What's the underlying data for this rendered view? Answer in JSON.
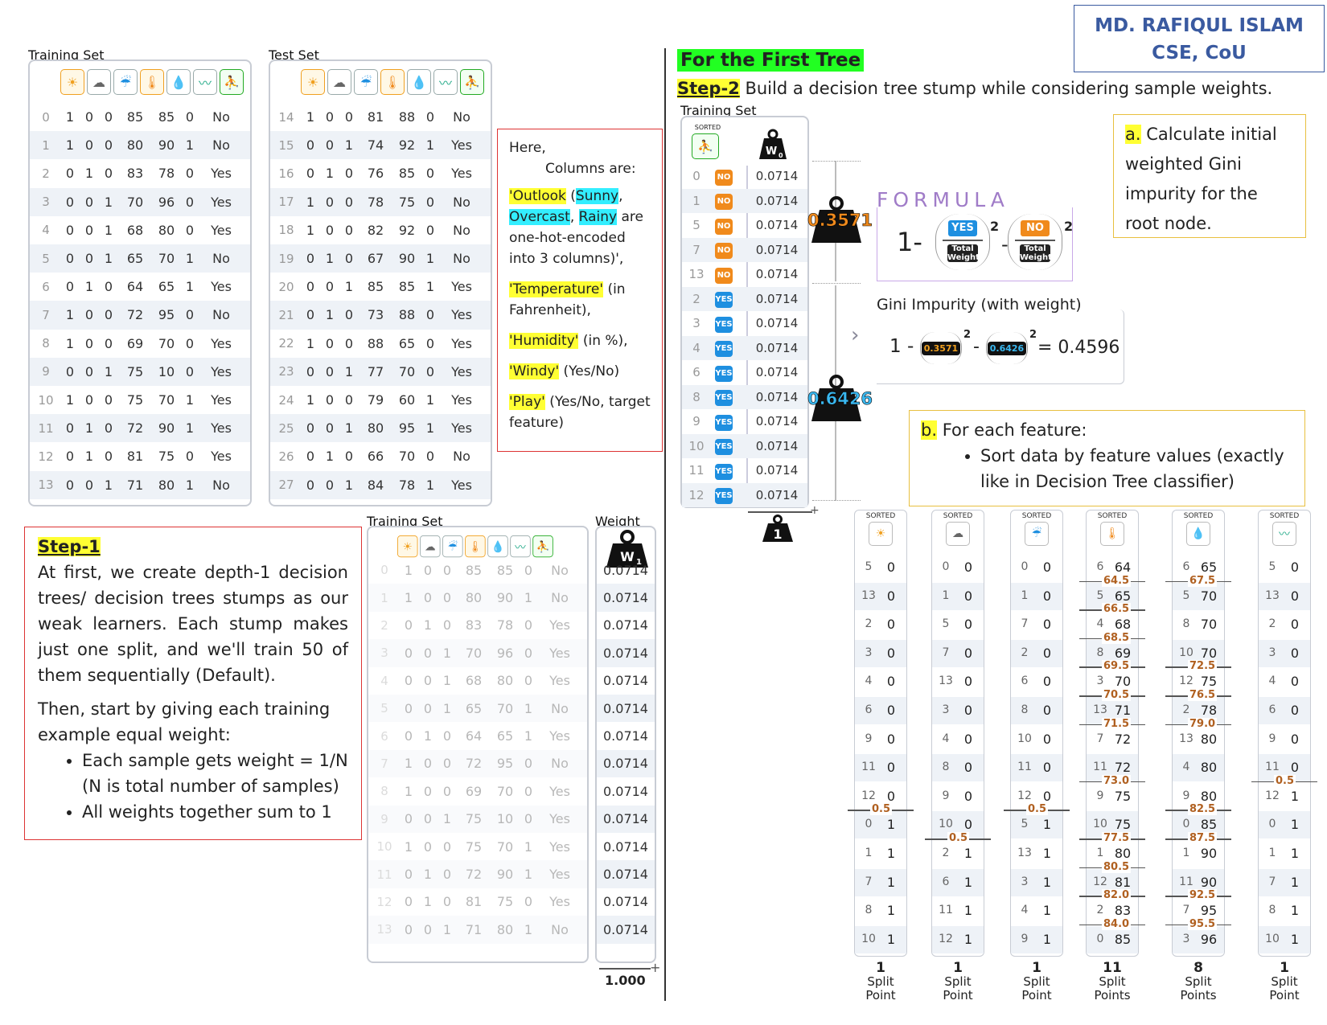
{
  "author": {
    "name": "MD. RAFIQUL ISLAM",
    "dept": "CSE, CoU"
  },
  "training_title": "Training Set",
  "test_title": "Test Set",
  "feature_icons": [
    "sunny-icon",
    "overcast-icon",
    "rainy-icon",
    "temperature-icon",
    "humidity-icon",
    "windy-icon",
    "play-icon"
  ],
  "training_rows": [
    [
      "0",
      "1",
      "0",
      "0",
      "85",
      "85",
      "0",
      "No"
    ],
    [
      "1",
      "1",
      "0",
      "0",
      "80",
      "90",
      "1",
      "No"
    ],
    [
      "2",
      "0",
      "1",
      "0",
      "83",
      "78",
      "0",
      "Yes"
    ],
    [
      "3",
      "0",
      "0",
      "1",
      "70",
      "96",
      "0",
      "Yes"
    ],
    [
      "4",
      "0",
      "0",
      "1",
      "68",
      "80",
      "0",
      "Yes"
    ],
    [
      "5",
      "0",
      "0",
      "1",
      "65",
      "70",
      "1",
      "No"
    ],
    [
      "6",
      "0",
      "1",
      "0",
      "64",
      "65",
      "1",
      "Yes"
    ],
    [
      "7",
      "1",
      "0",
      "0",
      "72",
      "95",
      "0",
      "No"
    ],
    [
      "8",
      "1",
      "0",
      "0",
      "69",
      "70",
      "0",
      "Yes"
    ],
    [
      "9",
      "0",
      "0",
      "1",
      "75",
      "10",
      "0",
      "Yes"
    ],
    [
      "10",
      "1",
      "0",
      "0",
      "75",
      "70",
      "1",
      "Yes"
    ],
    [
      "11",
      "0",
      "1",
      "0",
      "72",
      "90",
      "1",
      "Yes"
    ],
    [
      "12",
      "0",
      "1",
      "0",
      "81",
      "75",
      "0",
      "Yes"
    ],
    [
      "13",
      "0",
      "0",
      "1",
      "71",
      "80",
      "1",
      "No"
    ]
  ],
  "test_rows": [
    [
      "14",
      "1",
      "0",
      "0",
      "81",
      "88",
      "0",
      "No"
    ],
    [
      "15",
      "0",
      "0",
      "1",
      "74",
      "92",
      "1",
      "Yes"
    ],
    [
      "16",
      "0",
      "1",
      "0",
      "76",
      "85",
      "0",
      "Yes"
    ],
    [
      "17",
      "1",
      "0",
      "0",
      "78",
      "75",
      "0",
      "No"
    ],
    [
      "18",
      "1",
      "0",
      "0",
      "82",
      "92",
      "0",
      "No"
    ],
    [
      "19",
      "0",
      "1",
      "0",
      "67",
      "90",
      "1",
      "No"
    ],
    [
      "20",
      "0",
      "0",
      "1",
      "85",
      "85",
      "1",
      "Yes"
    ],
    [
      "21",
      "0",
      "1",
      "0",
      "73",
      "88",
      "0",
      "Yes"
    ],
    [
      "22",
      "1",
      "0",
      "0",
      "88",
      "65",
      "0",
      "Yes"
    ],
    [
      "23",
      "0",
      "0",
      "1",
      "77",
      "70",
      "0",
      "Yes"
    ],
    [
      "24",
      "1",
      "0",
      "0",
      "79",
      "60",
      "1",
      "Yes"
    ],
    [
      "25",
      "0",
      "0",
      "1",
      "80",
      "95",
      "1",
      "Yes"
    ],
    [
      "26",
      "0",
      "1",
      "0",
      "66",
      "70",
      "0",
      "No"
    ],
    [
      "27",
      "0",
      "0",
      "1",
      "84",
      "78",
      "1",
      "Yes"
    ]
  ],
  "note": {
    "here": "Here,",
    "cols": "Columns are:",
    "outlook": "'Outlook",
    "open": " (",
    "sunny": "Sunny",
    ",": ",",
    "overcast": "Overcast",
    "rainy": "Rainy",
    "are": " are",
    "encoded": "one-hot-encoded into 3 columns)',",
    "temperature": "'Temperature'",
    "temp_unit": " (in Fahrenheit),",
    "humidity": "'Humidity'",
    "hum_unit": " (in %),",
    "windy": "'Windy'",
    "windy_unit": " (Yes/No)",
    "play": "'Play'",
    "play_unit": " (Yes/No, target feature)"
  },
  "step1": {
    "title": "Step-1",
    "p1": "At first, we create depth-1 decision trees/ decision trees stumps as our weak learners. Each stump makes just one split, and we'll train 50 of them sequentially (Default).",
    "p2": "Then, start by giving each training example equal weight:",
    "b1": "Each sample gets weight = 1/N (N is total number of samples)",
    "b2": "All weights together sum to 1"
  },
  "weight_title": "Weight",
  "weight_value": "0.0714",
  "weight_sum": "1.000",
  "w1_label": "W1",
  "first_tree": "For the First Tree",
  "step2": {
    "title": "Step-2",
    "text": " Build a decision tree stump while considering sample weights."
  },
  "sorted_label": "SORTED",
  "w0_label": "W0",
  "sorted_rows": [
    [
      "0",
      "NO"
    ],
    [
      "1",
      "NO"
    ],
    [
      "5",
      "NO"
    ],
    [
      "7",
      "NO"
    ],
    [
      "13",
      "NO"
    ],
    [
      "2",
      "YES"
    ],
    [
      "3",
      "YES"
    ],
    [
      "4",
      "YES"
    ],
    [
      "6",
      "YES"
    ],
    [
      "8",
      "YES"
    ],
    [
      "9",
      "YES"
    ],
    [
      "10",
      "YES"
    ],
    [
      "11",
      "YES"
    ],
    [
      "12",
      "YES"
    ]
  ],
  "weight_no": "0.3571",
  "weight_yes": "0.6426",
  "weight_one": "1",
  "formula": {
    "title": "FORMULA",
    "one": "1-",
    "minus": "-",
    "sq": "2",
    "yes": "YES",
    "no": "NO",
    "total": "Total Weight"
  },
  "gini": {
    "title": "Gini Impurity (with weight)",
    "one": "1 -",
    "minus": "-",
    "sq": "2",
    "result": "= 0.4596"
  },
  "step_a": {
    "letter": "a.",
    "text": " Calculate initial weighted Gini impurity for the root node."
  },
  "step_b": {
    "letter": "b.",
    "text": " For each feature:",
    "bullet": "Sort data by feature values (exactly like in Decision Tree classifier)"
  },
  "sorted_cols": [
    {
      "icon": "sunny-icon",
      "rows": [
        [
          "5",
          "0"
        ],
        [
          "13",
          "0"
        ],
        [
          "2",
          "0"
        ],
        [
          "3",
          "0"
        ],
        [
          "4",
          "0"
        ],
        [
          "6",
          "0"
        ],
        [
          "9",
          "0"
        ],
        [
          "11",
          "0"
        ],
        [
          "12",
          "0"
        ],
        [
          "0",
          "1"
        ],
        [
          "1",
          "1"
        ],
        [
          "7",
          "1"
        ],
        [
          "8",
          "1"
        ],
        [
          "10",
          "1"
        ]
      ],
      "splits": [
        [
          "0.5",
          8
        ]
      ],
      "count": "1",
      "label": "Split Point"
    },
    {
      "icon": "overcast-icon",
      "rows": [
        [
          "0",
          "0"
        ],
        [
          "1",
          "0"
        ],
        [
          "5",
          "0"
        ],
        [
          "7",
          "0"
        ],
        [
          "13",
          "0"
        ],
        [
          "3",
          "0"
        ],
        [
          "4",
          "0"
        ],
        [
          "8",
          "0"
        ],
        [
          "9",
          "0"
        ],
        [
          "10",
          "0"
        ],
        [
          "2",
          "1"
        ],
        [
          "6",
          "1"
        ],
        [
          "11",
          "1"
        ],
        [
          "12",
          "1"
        ]
      ],
      "splits": [
        [
          "0.5",
          9
        ]
      ],
      "count": "1",
      "label": "Split Point"
    },
    {
      "icon": "rainy-icon",
      "rows": [
        [
          "0",
          "0"
        ],
        [
          "1",
          "0"
        ],
        [
          "7",
          "0"
        ],
        [
          "2",
          "0"
        ],
        [
          "6",
          "0"
        ],
        [
          "8",
          "0"
        ],
        [
          "10",
          "0"
        ],
        [
          "11",
          "0"
        ],
        [
          "12",
          "0"
        ],
        [
          "5",
          "1"
        ],
        [
          "13",
          "1"
        ],
        [
          "3",
          "1"
        ],
        [
          "4",
          "1"
        ],
        [
          "9",
          "1"
        ]
      ],
      "splits": [
        [
          "0.5",
          8
        ]
      ],
      "count": "1",
      "label": "Split Point"
    },
    {
      "icon": "temperature-icon",
      "rows": [
        [
          "6",
          "64"
        ],
        [
          "5",
          "65"
        ],
        [
          "4",
          "68"
        ],
        [
          "8",
          "69"
        ],
        [
          "3",
          "70"
        ],
        [
          "13",
          "71"
        ],
        [
          "7",
          "72"
        ],
        [
          "11",
          "72"
        ],
        [
          "9",
          "75"
        ],
        [
          "10",
          "75"
        ],
        [
          "1",
          "80"
        ],
        [
          "12",
          "81"
        ],
        [
          "2",
          "83"
        ],
        [
          "0",
          "85"
        ]
      ],
      "splits": [
        [
          "64.5",
          0
        ],
        [
          "66.5",
          1
        ],
        [
          "68.5",
          2
        ],
        [
          "69.5",
          3
        ],
        [
          "70.5",
          4
        ],
        [
          "71.5",
          5
        ],
        [
          "73.0",
          7
        ],
        [
          "77.5",
          9
        ],
        [
          "80.5",
          10
        ],
        [
          "82.0",
          11
        ],
        [
          "84.0",
          12
        ]
      ],
      "count": "11",
      "label": "Split Points"
    },
    {
      "icon": "humidity-icon",
      "rows": [
        [
          "6",
          "65"
        ],
        [
          "5",
          "70"
        ],
        [
          "8",
          "70"
        ],
        [
          "10",
          "70"
        ],
        [
          "12",
          "75"
        ],
        [
          "2",
          "78"
        ],
        [
          "13",
          "80"
        ],
        [
          "4",
          "80"
        ],
        [
          "9",
          "80"
        ],
        [
          "0",
          "85"
        ],
        [
          "1",
          "90"
        ],
        [
          "11",
          "90"
        ],
        [
          "7",
          "95"
        ],
        [
          "3",
          "96"
        ]
      ],
      "splits": [
        [
          "67.5",
          0
        ],
        [
          "72.5",
          3
        ],
        [
          "76.5",
          4
        ],
        [
          "79.0",
          5
        ],
        [
          "82.5",
          8
        ],
        [
          "87.5",
          9
        ],
        [
          "92.5",
          11
        ],
        [
          "95.5",
          12
        ]
      ],
      "count": "8",
      "label": "Split Points"
    },
    {
      "icon": "windy-icon",
      "rows": [
        [
          "5",
          "0"
        ],
        [
          "13",
          "0"
        ],
        [
          "2",
          "0"
        ],
        [
          "3",
          "0"
        ],
        [
          "4",
          "0"
        ],
        [
          "6",
          "0"
        ],
        [
          "9",
          "0"
        ],
        [
          "11",
          "0"
        ],
        [
          "12",
          "1"
        ],
        [
          "0",
          "1"
        ],
        [
          "1",
          "1"
        ],
        [
          "7",
          "1"
        ],
        [
          "8",
          "1"
        ],
        [
          "10",
          "1"
        ]
      ],
      "splits": [
        [
          "0.5",
          7
        ]
      ],
      "count": "1",
      "label": "Split Point"
    }
  ]
}
